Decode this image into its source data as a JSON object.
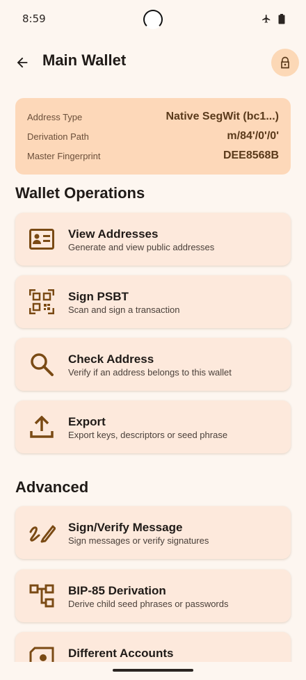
{
  "status": {
    "time": "8:59"
  },
  "header": {
    "title": "Main Wallet"
  },
  "wallet_info": {
    "rows": [
      {
        "label": "Address Type",
        "value": "Native SegWit (bc1...)"
      },
      {
        "label": "Derivation Path",
        "value": "m/84'/0'/0'"
      },
      {
        "label": "Master Fingerprint",
        "value": "DEE8568B"
      }
    ]
  },
  "sections": {
    "operations_title": "Wallet Operations",
    "advanced_title": "Advanced"
  },
  "operations": [
    {
      "title": "View Addresses",
      "subtitle": "Generate and view public addresses",
      "icon": "id-card-icon"
    },
    {
      "title": "Sign PSBT",
      "subtitle": "Scan and sign a transaction",
      "icon": "qr-code-icon"
    },
    {
      "title": "Check Address",
      "subtitle": "Verify if an address belongs to this wallet",
      "icon": "search-icon"
    },
    {
      "title": "Export",
      "subtitle": "Export keys, descriptors or seed phrase",
      "icon": "upload-icon"
    }
  ],
  "advanced": [
    {
      "title": "Sign/Verify Message",
      "subtitle": "Sign messages or verify signatures",
      "icon": "signature-icon"
    },
    {
      "title": "BIP-85 Derivation",
      "subtitle": "Derive child seed phrases or passwords",
      "icon": "tree-icon"
    },
    {
      "title": "Different Accounts",
      "subtitle": "",
      "icon": "account-box-icon"
    }
  ],
  "colors": {
    "background": "#fdf6f0",
    "info_card": "#fdd8b9",
    "card": "#fde9dc",
    "accent": "#7a4a14"
  }
}
